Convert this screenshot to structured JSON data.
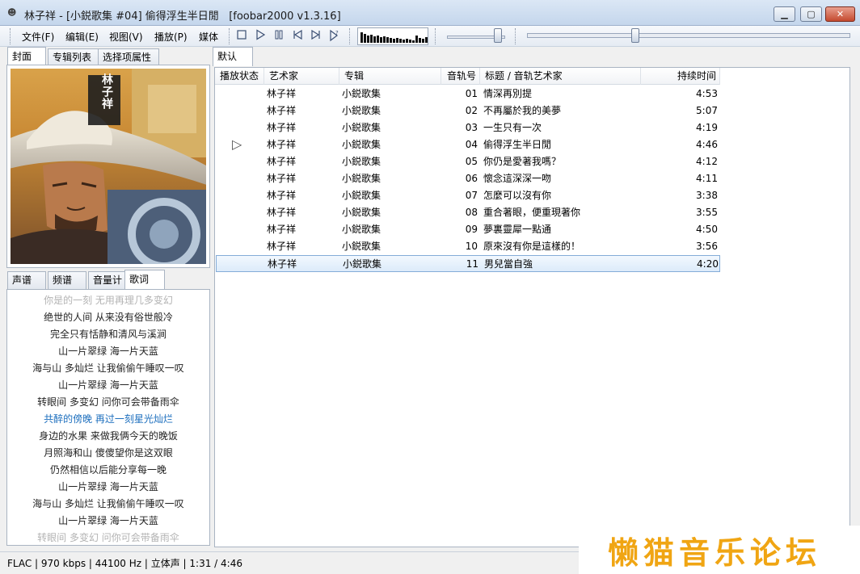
{
  "window": {
    "title": "林子祥 - [小鋭歌集 #04] 偷得浮生半日閒   [foobar2000 v1.3.16]",
    "controls": {
      "minimize": "▁",
      "maximize": "▢",
      "close": "✕"
    }
  },
  "menu": [
    "文件(F)",
    "编辑(E)",
    "视图(V)",
    "播放(P)",
    "媒体"
  ],
  "transport": {
    "stop_icon": "stop-icon",
    "play_icon": "play-icon",
    "pause_icon": "pause-icon",
    "prev_icon": "previous-icon",
    "next_icon": "next-icon",
    "random_icon": "random-icon",
    "volume_fraction": 0.83,
    "seek_fraction": 0.33
  },
  "visualizer_levels": [
    0.7,
    0.6,
    0.5,
    0.55,
    0.45,
    0.5,
    0.4,
    0.42,
    0.38,
    0.35,
    0.3,
    0.32,
    0.25,
    0.2,
    0.28,
    0.22,
    0.18,
    0.5,
    0.35,
    0.25,
    0.4,
    0.3
  ],
  "left_tabs": [
    "封面",
    "专辑列表",
    "选择项属性"
  ],
  "left_tabs_active": 0,
  "cover": {
    "artist_text": "林子祥"
  },
  "bottom_tabs": [
    "声谱",
    "频谱",
    "音量计",
    "歌词"
  ],
  "bottom_tabs_active": 3,
  "lyrics": [
    {
      "text": "你是的一刻 无用再理几多变幻",
      "state": "faded"
    },
    {
      "text": "绝世的人间 从来没有俗世般冷",
      "state": "normal"
    },
    {
      "text": "完全只有恬静和清风与溪涧",
      "state": "normal"
    },
    {
      "text": "山一片翠绿 海一片天蓝",
      "state": "normal"
    },
    {
      "text": "海与山 多灿烂 让我偷偷午睡叹一叹",
      "state": "normal"
    },
    {
      "text": "山一片翠绿 海一片天蓝",
      "state": "normal"
    },
    {
      "text": "转眼间 多变幻 问你可会带备雨伞",
      "state": "normal"
    },
    {
      "text": "共醉的傍晚 再过一刻星光灿烂",
      "state": "current"
    },
    {
      "text": "身边的水果 来做我俩今天的晚饭",
      "state": "normal"
    },
    {
      "text": "月照海和山 傻傻望你是这双眼",
      "state": "normal"
    },
    {
      "text": "仍然相信以后能分享每一晚",
      "state": "normal"
    },
    {
      "text": "山一片翠绿 海一片天蓝",
      "state": "normal"
    },
    {
      "text": "海与山 多灿烂 让我偷偷午睡叹一叹",
      "state": "normal"
    },
    {
      "text": "山一片翠绿 海一片天蓝",
      "state": "normal"
    },
    {
      "text": "转眼间 多变幻 问你可会带备雨伞",
      "state": "faded"
    }
  ],
  "playlist_tab": "默认",
  "playlist": {
    "columns": [
      "播放状态",
      "艺术家",
      "专辑",
      "音轨号",
      "标题 / 音轨艺术家",
      "持续时间"
    ],
    "playing_icon": "▷",
    "rows": [
      {
        "artist": "林子祥",
        "album": "小鋭歌集",
        "track": "01",
        "title": "情深再別提",
        "duration": "4:53",
        "playing": false,
        "selected": false
      },
      {
        "artist": "林子祥",
        "album": "小鋭歌集",
        "track": "02",
        "title": "不再屬於我的美夢",
        "duration": "5:07",
        "playing": false,
        "selected": false
      },
      {
        "artist": "林子祥",
        "album": "小鋭歌集",
        "track": "03",
        "title": "一生只有一次",
        "duration": "4:19",
        "playing": false,
        "selected": false
      },
      {
        "artist": "林子祥",
        "album": "小鋭歌集",
        "track": "04",
        "title": "偷得浮生半日閒",
        "duration": "4:46",
        "playing": true,
        "selected": false
      },
      {
        "artist": "林子祥",
        "album": "小鋭歌集",
        "track": "05",
        "title": "你仍是愛著我嗎？",
        "duration": "4:12",
        "playing": false,
        "selected": false
      },
      {
        "artist": "林子祥",
        "album": "小鋭歌集",
        "track": "06",
        "title": "懷念這深深一吻",
        "duration": "4:11",
        "playing": false,
        "selected": false
      },
      {
        "artist": "林子祥",
        "album": "小鋭歌集",
        "track": "07",
        "title": "怎麼可以沒有你",
        "duration": "3:38",
        "playing": false,
        "selected": false
      },
      {
        "artist": "林子祥",
        "album": "小鋭歌集",
        "track": "08",
        "title": "重合著眼，便重現著你",
        "duration": "3:55",
        "playing": false,
        "selected": false
      },
      {
        "artist": "林子祥",
        "album": "小鋭歌集",
        "track": "09",
        "title": "夢裏靈犀一點通",
        "duration": "4:50",
        "playing": false,
        "selected": false
      },
      {
        "artist": "林子祥",
        "album": "小鋭歌集",
        "track": "10",
        "title": "原來沒有你是這樣的！",
        "duration": "3:56",
        "playing": false,
        "selected": false
      },
      {
        "artist": "林子祥",
        "album": "小鋭歌集",
        "track": "11",
        "title": "男兒當自強",
        "duration": "4:20",
        "playing": false,
        "selected": true
      }
    ]
  },
  "status": "FLAC | 970 kbps | 44100 Hz | 立体声 | 1:31 / 4:46",
  "watermark": "懒猫音乐论坛"
}
